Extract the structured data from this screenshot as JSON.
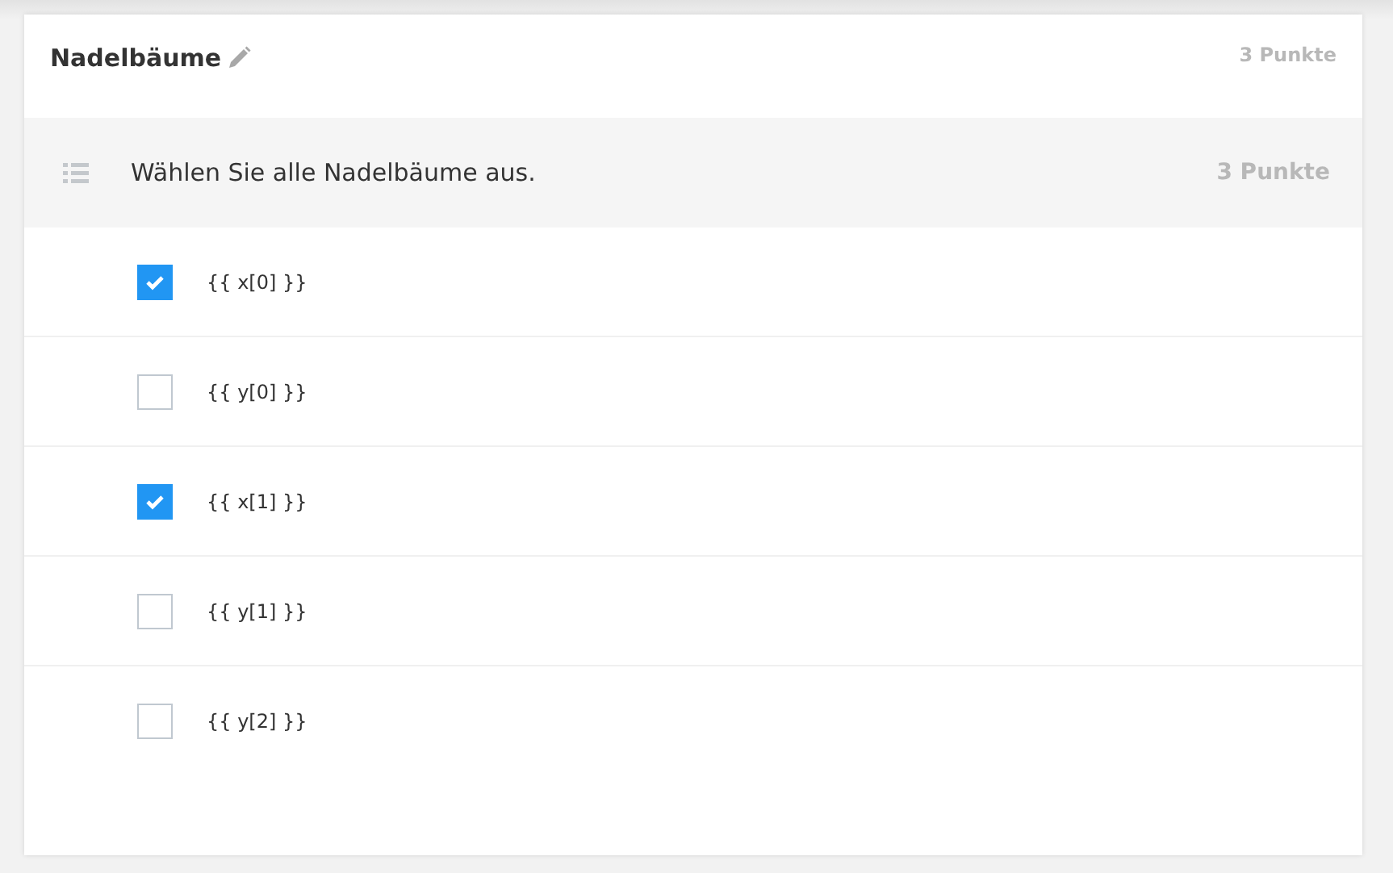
{
  "card": {
    "title": "Nadelbäume",
    "points": "3 Punkte"
  },
  "question": {
    "text": "Wählen Sie alle Nadelbäume aus.",
    "points": "3 Punkte"
  },
  "options": [
    {
      "label": "{{ x[0] }}",
      "checked": true
    },
    {
      "label": "{{ y[0] }}",
      "checked": false
    },
    {
      "label": "{{ x[1] }}",
      "checked": true
    },
    {
      "label": "{{ y[1] }}",
      "checked": false
    },
    {
      "label": "{{ y[2] }}",
      "checked": false
    }
  ]
}
